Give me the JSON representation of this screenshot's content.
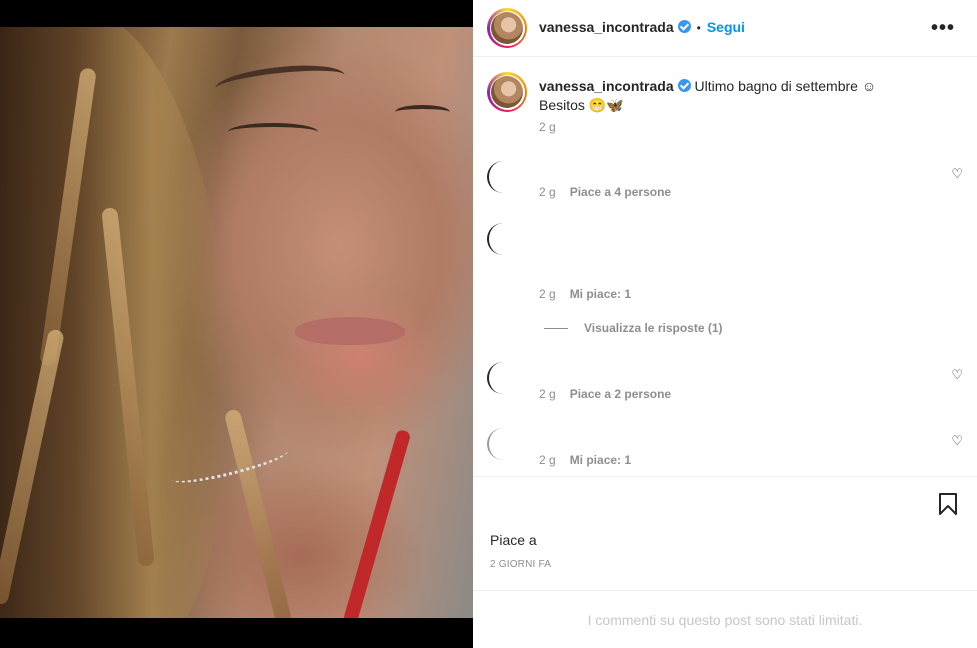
{
  "post": {
    "username": "vanessa_incontrada",
    "separator": "•",
    "follow_label": "Segui",
    "more_label": "•••",
    "caption_text": "Ultimo bagno di settembre ☺",
    "caption_line2": "Besitos 😁🦋",
    "caption_time": "2 g"
  },
  "comments": [
    {
      "time": "2 g",
      "likes": "Piace a 4 persone"
    },
    {
      "time": "2 g",
      "likes": "Mi piace: 1"
    },
    {
      "time": "2 g",
      "likes": "Piace a 2 persone"
    },
    {
      "time": "2 g",
      "likes": "Mi piace: 1"
    }
  ],
  "replies_label": "Visualizza le risposte (1)",
  "footer": {
    "likes_text": "Piace a ",
    "date_text": "2 GIORNI FA",
    "limited_text": "I commenti su questo post sono stati limitati."
  },
  "icons": {
    "verified": "verified-badge-icon",
    "heart": "heart-icon",
    "bookmark": "bookmark-icon",
    "more": "more-options-icon"
  },
  "colors": {
    "link": "#0095f6",
    "verified": "#3897f0",
    "muted": "#8e8e8e"
  }
}
